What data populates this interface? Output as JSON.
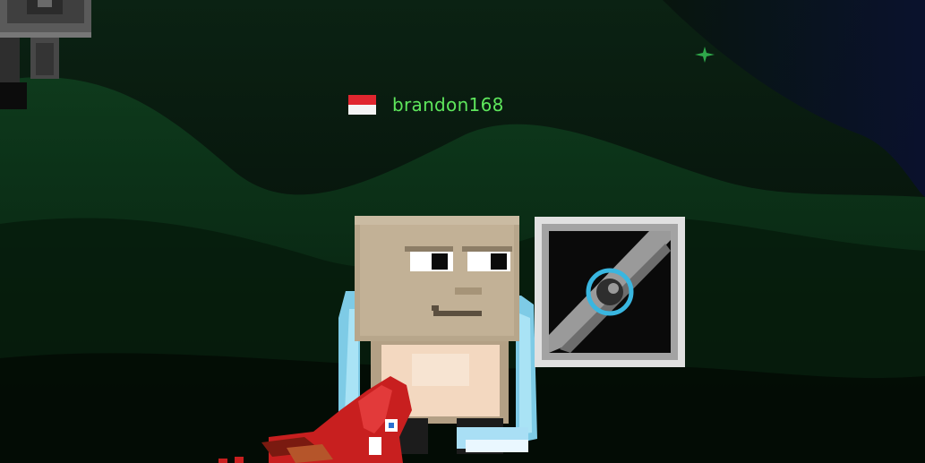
{
  "player": {
    "name": "brandon168",
    "flag_icon": "red-white-flag-icon",
    "name_color": "#5ee65c"
  },
  "colors": {
    "background": "#030604",
    "hill": "#0a2a16",
    "skin": "#b7a68b",
    "wings": "#7ecbe6",
    "lock_frame": "#e0e0e0",
    "dragon": "#c81f1f"
  },
  "items": {
    "lock_block_icon": "steel-lock-block-icon",
    "sign_icon": "gray-sign-post-icon",
    "pet_icon": "red-dragon-pet-icon",
    "star_icon": "green-star-icon"
  }
}
